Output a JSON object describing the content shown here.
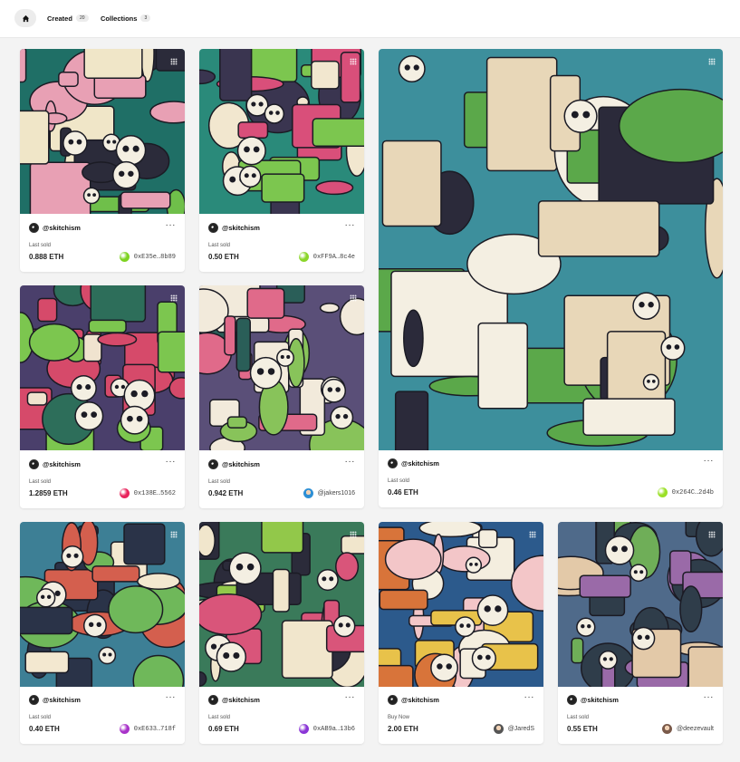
{
  "nav": {
    "home_icon": "home-icon",
    "tabs": [
      {
        "label": "Created",
        "count": "20"
      },
      {
        "label": "Collections",
        "count": "3"
      }
    ]
  },
  "cards": [
    {
      "creator": "@skitchism",
      "sale_label": "Last sold",
      "price": "0.888 ETH",
      "owner": "0xE35e…8b89",
      "owner_style": "address",
      "owner_color": "#7ed321",
      "art_colors": [
        "#1f6f66",
        "#e8a0b4",
        "#f0e6c8",
        "#2b2b3a",
        "#6fbf4a"
      ]
    },
    {
      "creator": "@skitchism",
      "sale_label": "Last sold",
      "price": "0.50 ETH",
      "owner": "0xFF9A…8c4e",
      "owner_style": "address",
      "owner_color": "#8bd62a",
      "art_colors": [
        "#2a8a7a",
        "#d94f7a",
        "#f2e7cf",
        "#3a3550",
        "#7cc64f"
      ]
    },
    {
      "creator": "@skitchism",
      "sale_label": "Last sold",
      "price": "0.46 ETH",
      "owner": "0x264C…2d4b",
      "owner_style": "address",
      "owner_color": "#9be028",
      "art_colors": [
        "#3d8f9c",
        "#e8d7b8",
        "#f4efe2",
        "#2b2a3a",
        "#5ba84a"
      ]
    },
    {
      "creator": "@skitchism",
      "sale_label": "Last sold",
      "price": "1.2859 ETH",
      "owner": "0x138E…5562",
      "owner_style": "address",
      "owner_color": "#e8245c",
      "art_colors": [
        "#4a3f6b",
        "#d64a6a",
        "#f0e3cf",
        "#2d6e5a",
        "#7cc64f"
      ]
    },
    {
      "creator": "@skitchism",
      "sale_label": "Last sold",
      "price": "0.942 ETH",
      "owner": "@jakers1016",
      "owner_style": "user",
      "owner_color": "#2d8fd5",
      "art_colors": [
        "#5a4f78",
        "#e06a8a",
        "#f2eadb",
        "#2a5e58",
        "#88c35a"
      ]
    },
    {
      "creator": "@skitchism",
      "sale_label": "Last sold",
      "price": "0.40 ETH",
      "owner": "0xE633…718f",
      "owner_style": "address",
      "owner_color": "#a832c9",
      "art_colors": [
        "#3d7f95",
        "#f3e8d0",
        "#d45f4e",
        "#2a3348",
        "#6fb85a"
      ]
    },
    {
      "creator": "@skitchism",
      "sale_label": "Last sold",
      "price": "0.69 ETH",
      "owner": "0xAB9a…13b6",
      "owner_style": "address",
      "owner_color": "#8a35d6",
      "art_colors": [
        "#3a7a5a",
        "#d9557a",
        "#f1e6cc",
        "#2b2b3a",
        "#92c84a"
      ]
    },
    {
      "creator": "@skitchism",
      "sale_label": "Buy Now",
      "price": "2.00 ETH",
      "owner": "@JaredS",
      "owner_style": "user",
      "owner_color": "#555555",
      "art_colors": [
        "#2c5a8c",
        "#f3c6c8",
        "#f4eedf",
        "#d8743a",
        "#e8c24a"
      ]
    },
    {
      "creator": "@skitchism",
      "sale_label": "Last sold",
      "price": "0.55 ETH",
      "owner": "@deezevault",
      "owner_style": "user",
      "owner_color": "#7a5a4a",
      "art_colors": [
        "#4f6a8a",
        "#e3c9a8",
        "#9a6aa8",
        "#2f3d4a",
        "#6fae58"
      ]
    }
  ]
}
